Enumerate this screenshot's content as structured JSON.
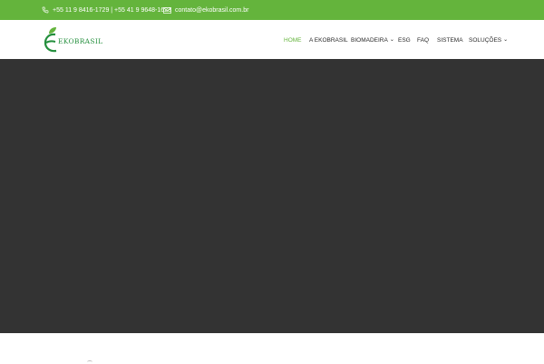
{
  "topbar": {
    "phone_icon": "phone-icon",
    "phone": "+55 11 9 8416-1729 | +55 41 9 9648-1623",
    "email_icon": "envelope-icon",
    "email": "contato@ekobrasil.com.br"
  },
  "logo": {
    "icon": "leaf-logo-icon",
    "text": "EKOBRASIL"
  },
  "nav": {
    "items": [
      {
        "label": "HOME",
        "active": true
      },
      {
        "label": "A EKOBRASIL"
      },
      {
        "label": "BIOMADEIRA",
        "dropdown": true
      },
      {
        "label": "ESG"
      },
      {
        "label": "FAQ"
      },
      {
        "label": "SISTEMA"
      },
      {
        "label": "SOLUÇÕES",
        "dropdown": true
      }
    ]
  },
  "colors": {
    "brand_green": "#64b43c",
    "logo_green": "#238e3c",
    "hero_bg": "#333333"
  }
}
